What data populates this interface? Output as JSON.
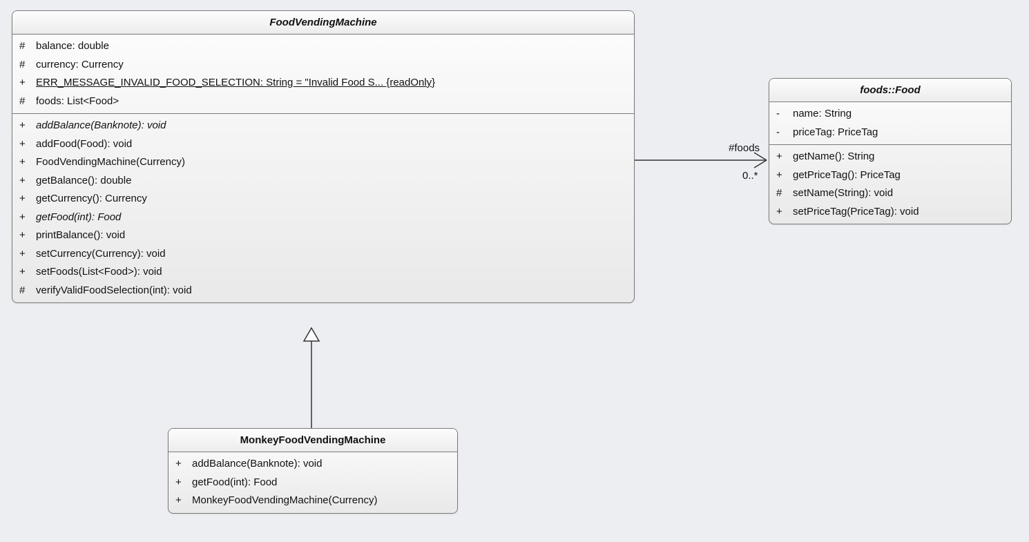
{
  "classes": {
    "fvm": {
      "name": "FoodVendingMachine",
      "abstract": true,
      "attributes": [
        {
          "vis": "#",
          "text": "balance: double"
        },
        {
          "vis": "#",
          "text": "currency: Currency"
        },
        {
          "vis": "+",
          "text": "ERR_MESSAGE_INVALID_FOOD_SELECTION: String = \"Invalid Food S... {readOnly}",
          "static": true
        },
        {
          "vis": "#",
          "text": "foods: List<Food>"
        }
      ],
      "operations": [
        {
          "vis": "+",
          "text": "addBalance(Banknote): void",
          "abstract": true
        },
        {
          "vis": "+",
          "text": "addFood(Food): void"
        },
        {
          "vis": "+",
          "text": "FoodVendingMachine(Currency)"
        },
        {
          "vis": "+",
          "text": "getBalance(): double"
        },
        {
          "vis": "+",
          "text": "getCurrency(): Currency"
        },
        {
          "vis": "+",
          "text": "getFood(int): Food",
          "abstract": true
        },
        {
          "vis": "+",
          "text": "printBalance(): void"
        },
        {
          "vis": "+",
          "text": "setCurrency(Currency): void"
        },
        {
          "vis": "+",
          "text": "setFoods(List<Food>): void"
        },
        {
          "vis": "#",
          "text": "verifyValidFoodSelection(int): void"
        }
      ]
    },
    "food": {
      "name": "foods::Food",
      "abstract": false,
      "attributes": [
        {
          "vis": "-",
          "text": "name: String"
        },
        {
          "vis": "-",
          "text": "priceTag: PriceTag"
        }
      ],
      "operations": [
        {
          "vis": "+",
          "text": "getName(): String"
        },
        {
          "vis": "+",
          "text": "getPriceTag(): PriceTag"
        },
        {
          "vis": "#",
          "text": "setName(String): void"
        },
        {
          "vis": "+",
          "text": "setPriceTag(PriceTag): void"
        }
      ]
    },
    "monkey": {
      "name": "MonkeyFoodVendingMachine",
      "abstract": false,
      "attributes": [],
      "operations": [
        {
          "vis": "+",
          "text": "addBalance(Banknote): void"
        },
        {
          "vis": "+",
          "text": "getFood(int): Food"
        },
        {
          "vis": "+",
          "text": "MonkeyFoodVendingMachine(Currency)"
        }
      ]
    }
  },
  "assoc": {
    "role": "#foods",
    "mult": "0..*"
  }
}
